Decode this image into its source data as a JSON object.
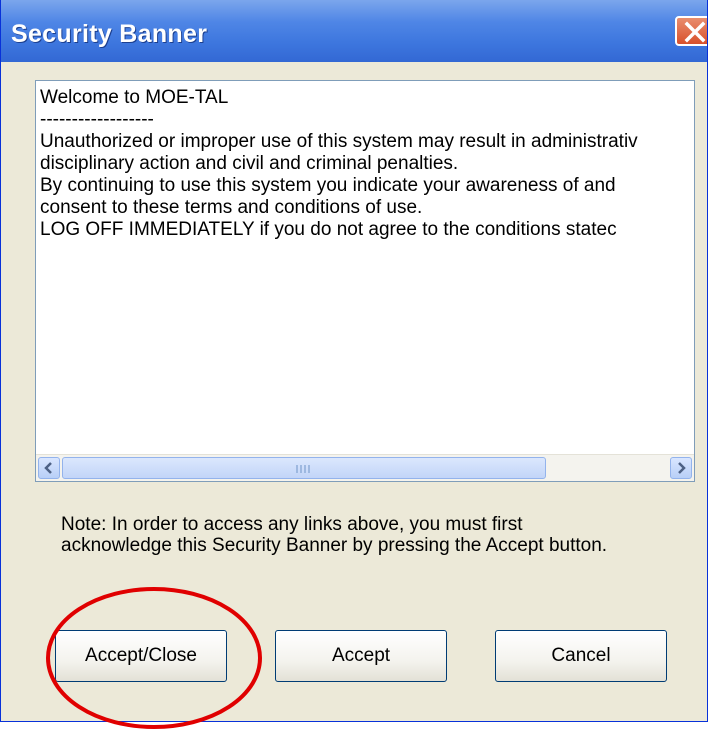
{
  "window": {
    "title": "Security Banner"
  },
  "banner_text": {
    "lines": [
      "Welcome to MOE-TAL",
      "------------------",
      "Unauthorized or improper use of this system may result in administrativ",
      "disciplinary action and civil and criminal penalties.",
      "By continuing to use this system you indicate your awareness of and",
      "consent to these terms and conditions of use.",
      "LOG OFF IMMEDIATELY if you do not agree to the conditions statec"
    ]
  },
  "note": {
    "text": "Note: In order to access any  links above, you must first acknowledge this Security Banner by pressing the Accept button."
  },
  "buttons": {
    "accept_close": "Accept/Close",
    "accept": "Accept",
    "cancel": "Cancel"
  },
  "colors": {
    "titlebar": "#3d76de",
    "dialog_background": "#ece9d8",
    "annotation_circle": "#e00000"
  }
}
